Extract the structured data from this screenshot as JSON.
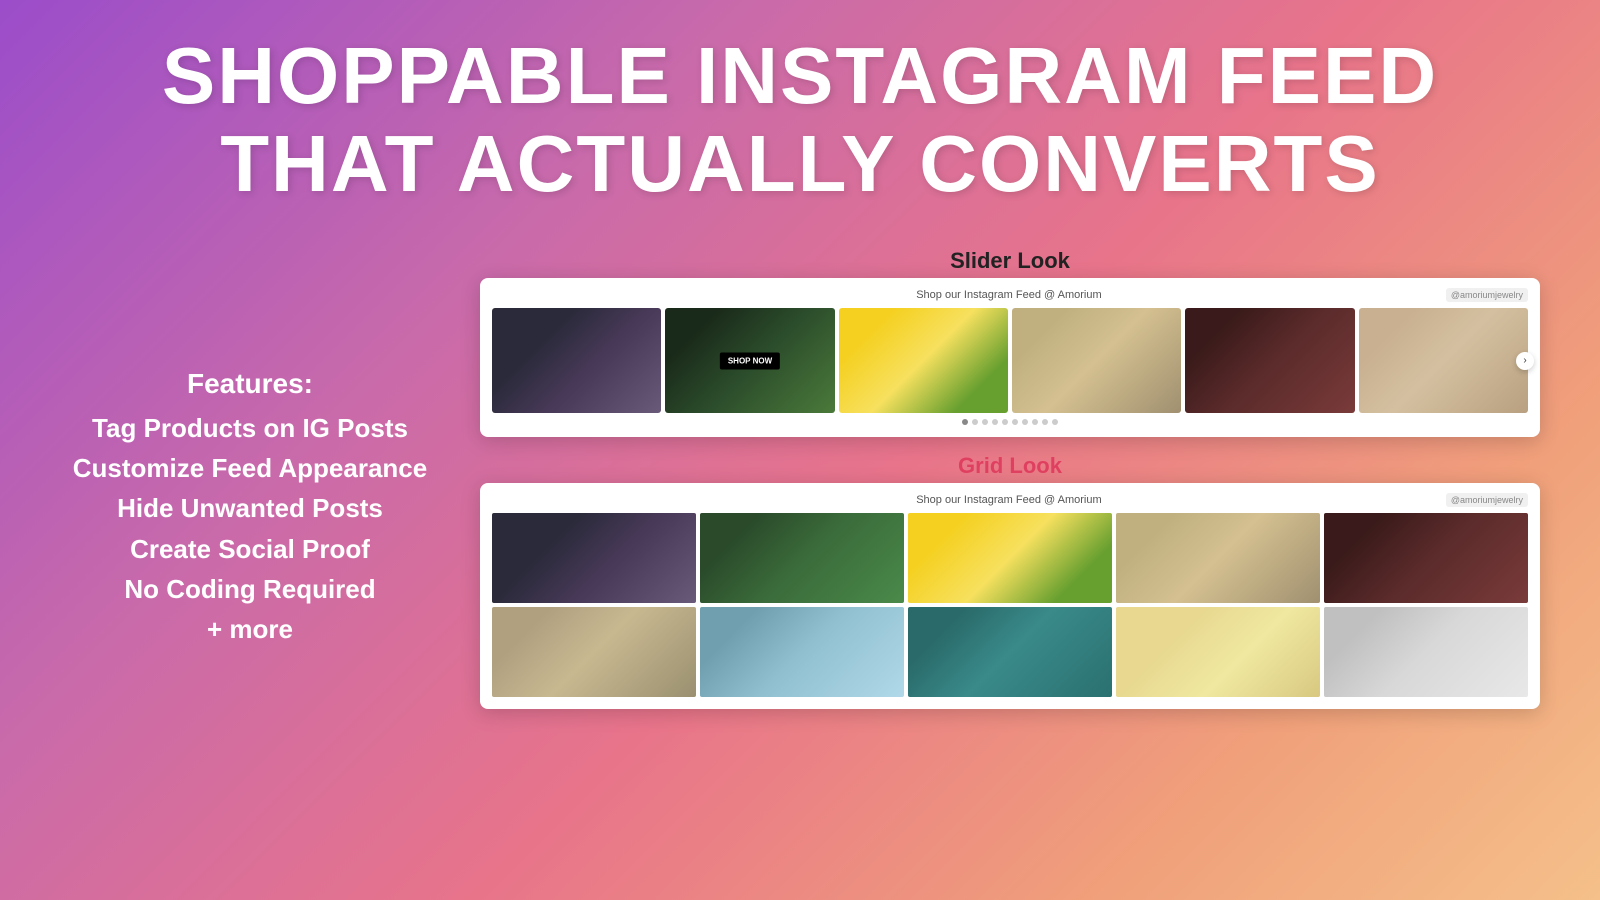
{
  "title": {
    "line1": "SHOPPABLE INSTAGRAM FEED",
    "line2": "THAT ACTUALLY CONVERTS"
  },
  "features": {
    "label": "Features:",
    "items": [
      "Tag Products on IG Posts",
      "Customize Feed Appearance",
      "Hide Unwanted Posts",
      "Create Social Proof",
      "No Coding Required",
      "+ more"
    ]
  },
  "slider_section": {
    "label": "Slider Look",
    "header_text": "Shop our Instagram Feed @ Amorium",
    "handle": "@amoriumjewelry",
    "shop_now": "SHOP NOW",
    "arrow": "›",
    "dots_count": 10,
    "active_dot": 0
  },
  "grid_section": {
    "label": "Grid Look",
    "header_text": "Shop our Instagram Feed @ Amorium",
    "handle": "@amoriumjewelry"
  },
  "colors": {
    "slider_label": "#222222",
    "grid_label": "#e04060",
    "features_text": "#ffffff",
    "title_text": "#ffffff"
  }
}
